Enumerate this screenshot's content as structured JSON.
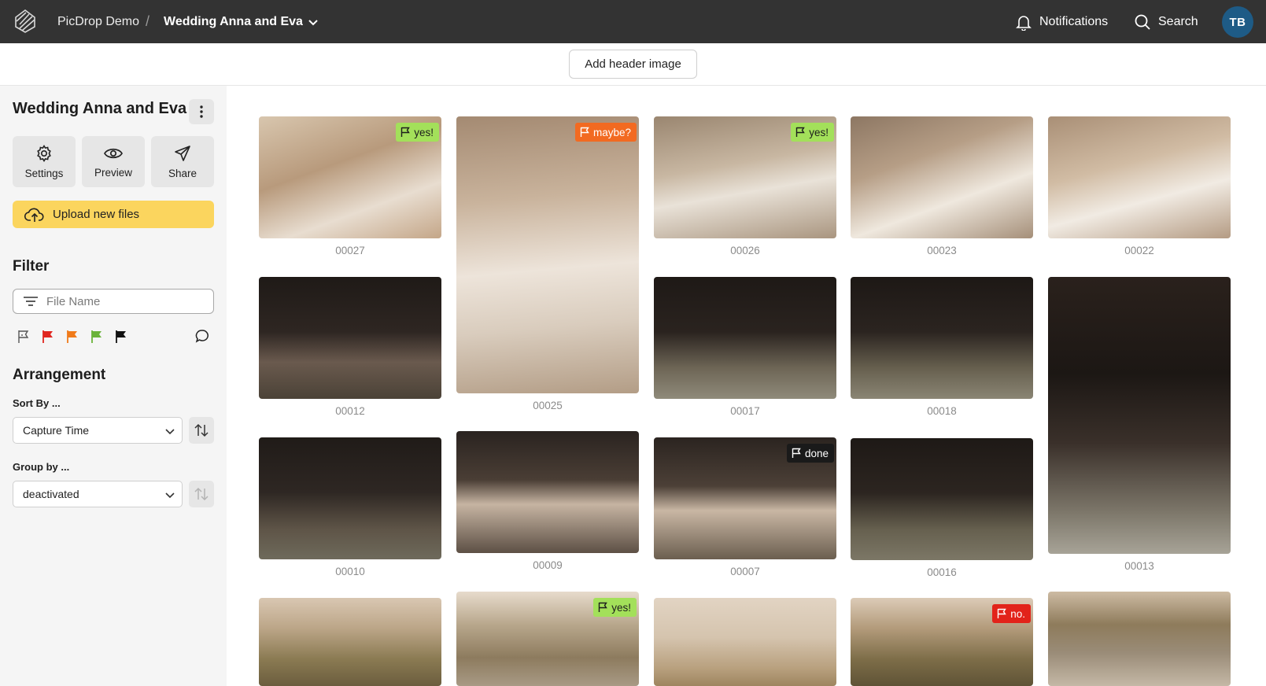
{
  "topbar": {
    "org_label": "PicDrop Demo",
    "separator": "/",
    "gallery_label": "Wedding Anna and Eva",
    "notifications_label": "Notifications",
    "search_label": "Search",
    "avatar_initials": "TB"
  },
  "header": {
    "add_header_image_label": "Add header image"
  },
  "sidebar": {
    "gallery_title": "Wedding Anna and Eva",
    "actions": [
      {
        "label": "Settings",
        "icon": "gear-icon"
      },
      {
        "label": "Preview",
        "icon": "eye-icon"
      },
      {
        "label": "Share",
        "icon": "send-icon"
      }
    ],
    "upload_label": "Upload new files",
    "filter_title": "Filter",
    "filename_placeholder": "File Name",
    "flag_filters": [
      {
        "name": "no-flag",
        "color": "#555555"
      },
      {
        "name": "red",
        "color": "#e0261f"
      },
      {
        "name": "orange",
        "color": "#f07a1a"
      },
      {
        "name": "green",
        "color": "#6bb33a"
      },
      {
        "name": "black",
        "color": "#111111"
      }
    ],
    "arrangement_title": "Arrangement",
    "sort_by_label": "Sort By ...",
    "sort_by_value": "Capture Time",
    "group_by_label": "Group by ...",
    "group_by_value": "deactivated"
  },
  "flag_colors": {
    "yes!": "#a3e05a",
    "maybe?": "#f26a21",
    "done": "#1a1a1a",
    "no.": "#e2231a"
  },
  "photos": [
    {
      "name": "00027",
      "flag": "yes!"
    },
    {
      "name": "00025",
      "flag": "maybe?"
    },
    {
      "name": "00026",
      "flag": "yes!"
    },
    {
      "name": "00023",
      "flag": ""
    },
    {
      "name": "00022",
      "flag": ""
    },
    {
      "name": "00012",
      "flag": ""
    },
    {
      "name": "00017",
      "flag": ""
    },
    {
      "name": "00018",
      "flag": ""
    },
    {
      "name": "00013",
      "flag": ""
    },
    {
      "name": "00010",
      "flag": ""
    },
    {
      "name": "00009",
      "flag": ""
    },
    {
      "name": "00007",
      "flag": "done"
    },
    {
      "name": "00016",
      "flag": ""
    },
    {
      "name": "",
      "flag": ""
    },
    {
      "name": "",
      "flag": "yes!"
    },
    {
      "name": "",
      "flag": ""
    },
    {
      "name": "",
      "flag": "no."
    },
    {
      "name": "",
      "flag": ""
    }
  ]
}
